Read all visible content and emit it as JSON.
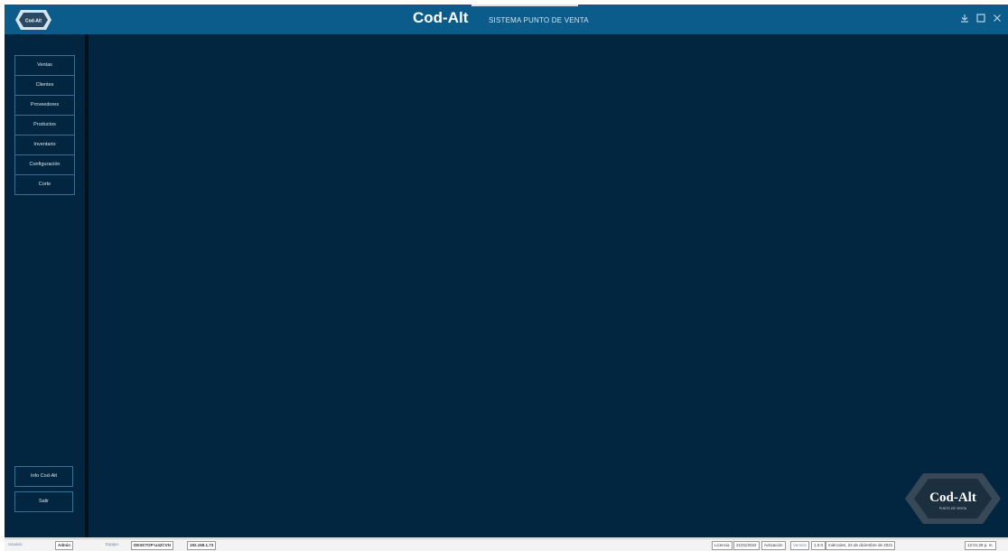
{
  "header": {
    "logo_text": "Cod-Alt",
    "title": "Cod-Alt",
    "subtitle": "SISTEMA PUNTO DE VENTA",
    "window_controls": [
      {
        "name": "minimize",
        "icon": "minimize-icon"
      },
      {
        "name": "restore",
        "icon": "restore-icon"
      },
      {
        "name": "close",
        "icon": "close-icon"
      }
    ]
  },
  "sidebar": {
    "items": [
      {
        "label": "Ventas"
      },
      {
        "label": "Clientes"
      },
      {
        "label": "Proveedores"
      },
      {
        "label": "Productos"
      },
      {
        "label": "Inventario"
      },
      {
        "label": "Configuración"
      },
      {
        "label": "Corte"
      }
    ],
    "bottom_items": [
      {
        "label": "Info Cod-Alt"
      },
      {
        "label": "Salir"
      }
    ]
  },
  "watermark": {
    "brand": "Cod-Alt",
    "tagline": "PUNTO DE VENTA"
  },
  "statusbar": {
    "user_label": "Usuario",
    "user_value": "Admin",
    "team_label": "Equipo",
    "host": "DESKTOP-U42CVN",
    "ip": "192.168.1.73",
    "license_label": "Licencia",
    "license_value": "21/01/2022",
    "activation_label": "Activación",
    "version_label": "Versión",
    "version_value": "1.0.0",
    "date_value": "miércoles, 22 de diciembre de 2021",
    "time_value": "12:01:28 p. m."
  },
  "colors": {
    "header_bg": "#0c5c8b",
    "main_bg": "#02263f",
    "accent_border": "#3a6f93"
  }
}
